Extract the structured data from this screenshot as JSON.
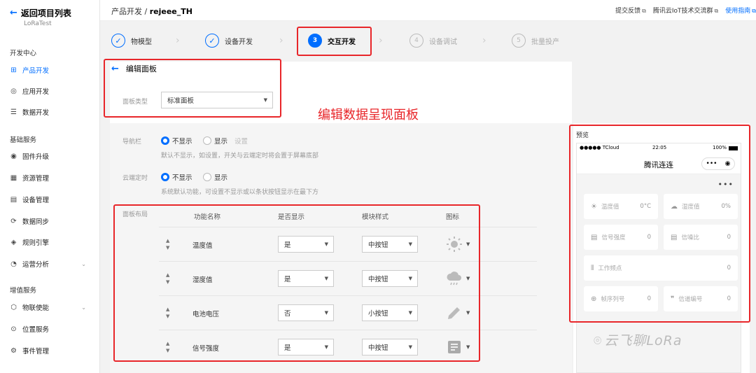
{
  "sidebar": {
    "back_label": "返回项目列表",
    "project": "LoRaTest",
    "sections": [
      {
        "title": "开发中心",
        "items": [
          {
            "label": "产品开发",
            "icon": "chip-icon",
            "active": true
          },
          {
            "label": "应用开发",
            "icon": "app-icon"
          },
          {
            "label": "数据开发",
            "icon": "data-icon"
          }
        ]
      },
      {
        "title": "基础服务",
        "items": [
          {
            "label": "固件升级",
            "icon": "firmware-icon"
          },
          {
            "label": "资源管理",
            "icon": "resource-icon"
          },
          {
            "label": "设备管理",
            "icon": "device-icon"
          },
          {
            "label": "数据同步",
            "icon": "sync-icon"
          },
          {
            "label": "规则引擎",
            "icon": "rule-icon"
          },
          {
            "label": "运营分析",
            "icon": "analytics-icon",
            "chevron": true
          }
        ]
      },
      {
        "title": "增值服务",
        "items": [
          {
            "label": "物联使能",
            "icon": "enable-icon",
            "chevron": true
          },
          {
            "label": "位置服务",
            "icon": "location-icon"
          },
          {
            "label": "事件管理",
            "icon": "event-icon"
          }
        ]
      }
    ]
  },
  "header": {
    "crumb_prefix": "产品开发 /",
    "product": "rejeee_TH",
    "links": [
      "提交反馈",
      "腾讯云IoT技术交流群",
      "使用指南"
    ]
  },
  "steps": [
    {
      "num": "✓",
      "label": "物模型",
      "state": "done"
    },
    {
      "num": "✓",
      "label": "设备开发",
      "state": "done"
    },
    {
      "num": "3",
      "label": "交互开发",
      "state": "current"
    },
    {
      "num": "4",
      "label": "设备调试",
      "state": "disabled"
    },
    {
      "num": "5",
      "label": "批量投产",
      "state": "disabled"
    }
  ],
  "edit": {
    "title": "编辑面板",
    "type_label": "面板类型",
    "type_value": "标准面板",
    "navbar_label": "导航栏",
    "navbar_opt_hide": "不显示",
    "navbar_opt_show": "显示",
    "navbar_setting": "设置",
    "navbar_hint": "默认不显示，如设置，开关与云端定时将会置于屏幕底部",
    "timer_label": "云端定时",
    "timer_opt_hide": "不显示",
    "timer_opt_show": "显示",
    "timer_hint": "系统默认功能，可设置不显示或以条状按钮显示在最下方",
    "layout_label": "面板布局"
  },
  "table": {
    "headers": [
      "功能名称",
      "是否显示",
      "模块样式",
      "图标"
    ],
    "rows": [
      {
        "name": "温度值",
        "show": "是",
        "style": "中按钮",
        "icon": "sun-icon"
      },
      {
        "name": "湿度值",
        "show": "是",
        "style": "中按钮",
        "icon": "cloud-rain-icon"
      },
      {
        "name": "电池电压",
        "show": "否",
        "style": "小按钮",
        "icon": "pencil-icon"
      },
      {
        "name": "信号强度",
        "show": "是",
        "style": "中按钮",
        "icon": "doc-icon"
      }
    ]
  },
  "annotation": "编辑数据呈现面板",
  "preview": {
    "label": "预览",
    "status_left": "●●●●● TCloud",
    "status_time": "22:05",
    "status_battery": "100%",
    "app_title": "腾讯连连",
    "more": "•••",
    "cards": [
      {
        "label": "温度值",
        "value": "0°C",
        "icon": "sun-icon"
      },
      {
        "label": "湿度值",
        "value": "0%",
        "icon": "cloud-icon"
      },
      {
        "label": "信号强度",
        "value": "0",
        "icon": "doc-icon"
      },
      {
        "label": "信噪比",
        "value": "0",
        "icon": "doc-icon"
      },
      {
        "label": "工作频点",
        "value": "0",
        "icon": "signal-icon"
      },
      {
        "label": "帧序列号",
        "value": "0",
        "icon": "plus-icon"
      },
      {
        "label": "信道编号",
        "value": "0",
        "icon": "quote-icon"
      }
    ]
  },
  "watermark": "云飞聊LoRa",
  "colors": {
    "accent": "#006eff",
    "annotation": "#e8262a"
  }
}
